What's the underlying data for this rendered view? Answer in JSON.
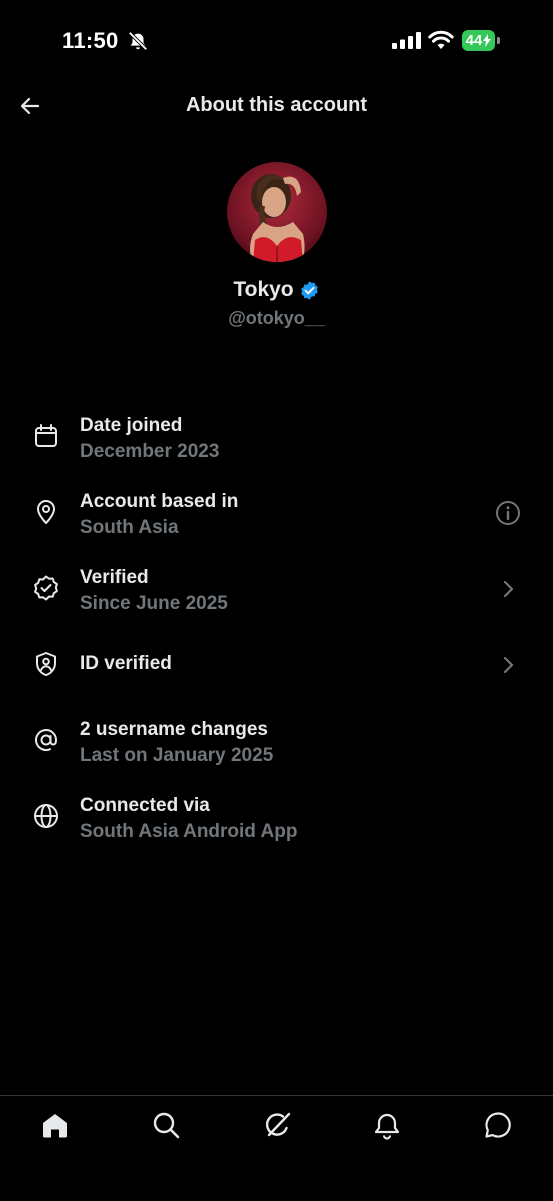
{
  "status_bar": {
    "time": "11:50",
    "battery_level": "44"
  },
  "header": {
    "title": "About this account"
  },
  "profile": {
    "name": "Tokyo",
    "handle": "@otokyo__"
  },
  "details": [
    {
      "title": "Date joined",
      "subtitle": "December 2023",
      "icon": "calendar-icon"
    },
    {
      "title": "Account based in",
      "subtitle": "South Asia",
      "icon": "location-pin-icon",
      "trailing": "info-icon"
    },
    {
      "title": "Verified",
      "subtitle": "Since June 2025",
      "icon": "verified-seal-icon",
      "trailing": "chevron-right-icon"
    },
    {
      "title": "ID verified",
      "icon": "id-shield-icon",
      "trailing": "chevron-right-icon"
    },
    {
      "title": "2 username changes",
      "subtitle": "Last on January 2025",
      "icon": "at-sign-icon"
    },
    {
      "title": "Connected via",
      "subtitle": "South Asia Android App",
      "icon": "globe-icon"
    }
  ],
  "bottom_nav": [
    {
      "icon": "home-icon"
    },
    {
      "icon": "search-icon"
    },
    {
      "icon": "grok-icon"
    },
    {
      "icon": "notifications-icon"
    },
    {
      "icon": "messages-icon"
    }
  ],
  "colors": {
    "background": "#000000",
    "primary_text": "#e7e9ea",
    "secondary_text": "#71767b",
    "verified_blue": "#1d9bf0",
    "battery_green": "#34c759"
  }
}
